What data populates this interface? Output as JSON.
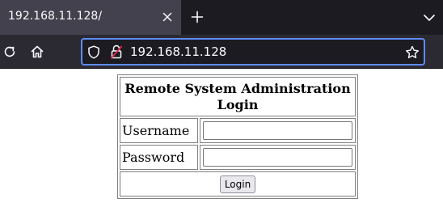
{
  "browser": {
    "tab": {
      "title": "192.168.11.128/"
    },
    "url": "192.168.11.128"
  },
  "icons": {
    "tab_close": "close-icon",
    "new_tab": "plus-icon",
    "tab_list": "chevron-down-icon",
    "reload": "reload-icon",
    "home": "home-icon",
    "tracking_protection": "shield-icon",
    "insecure_connection": "lock-insecure-icon",
    "bookmark": "star-icon"
  },
  "colors": {
    "url_bar_focus": "#5e8cf8",
    "insecure_lock": "#e22850"
  },
  "login": {
    "heading": "Remote System Administration Login",
    "username_label": "Username",
    "username_value": "",
    "password_label": "Password",
    "password_value": "",
    "button_label": "Login"
  }
}
